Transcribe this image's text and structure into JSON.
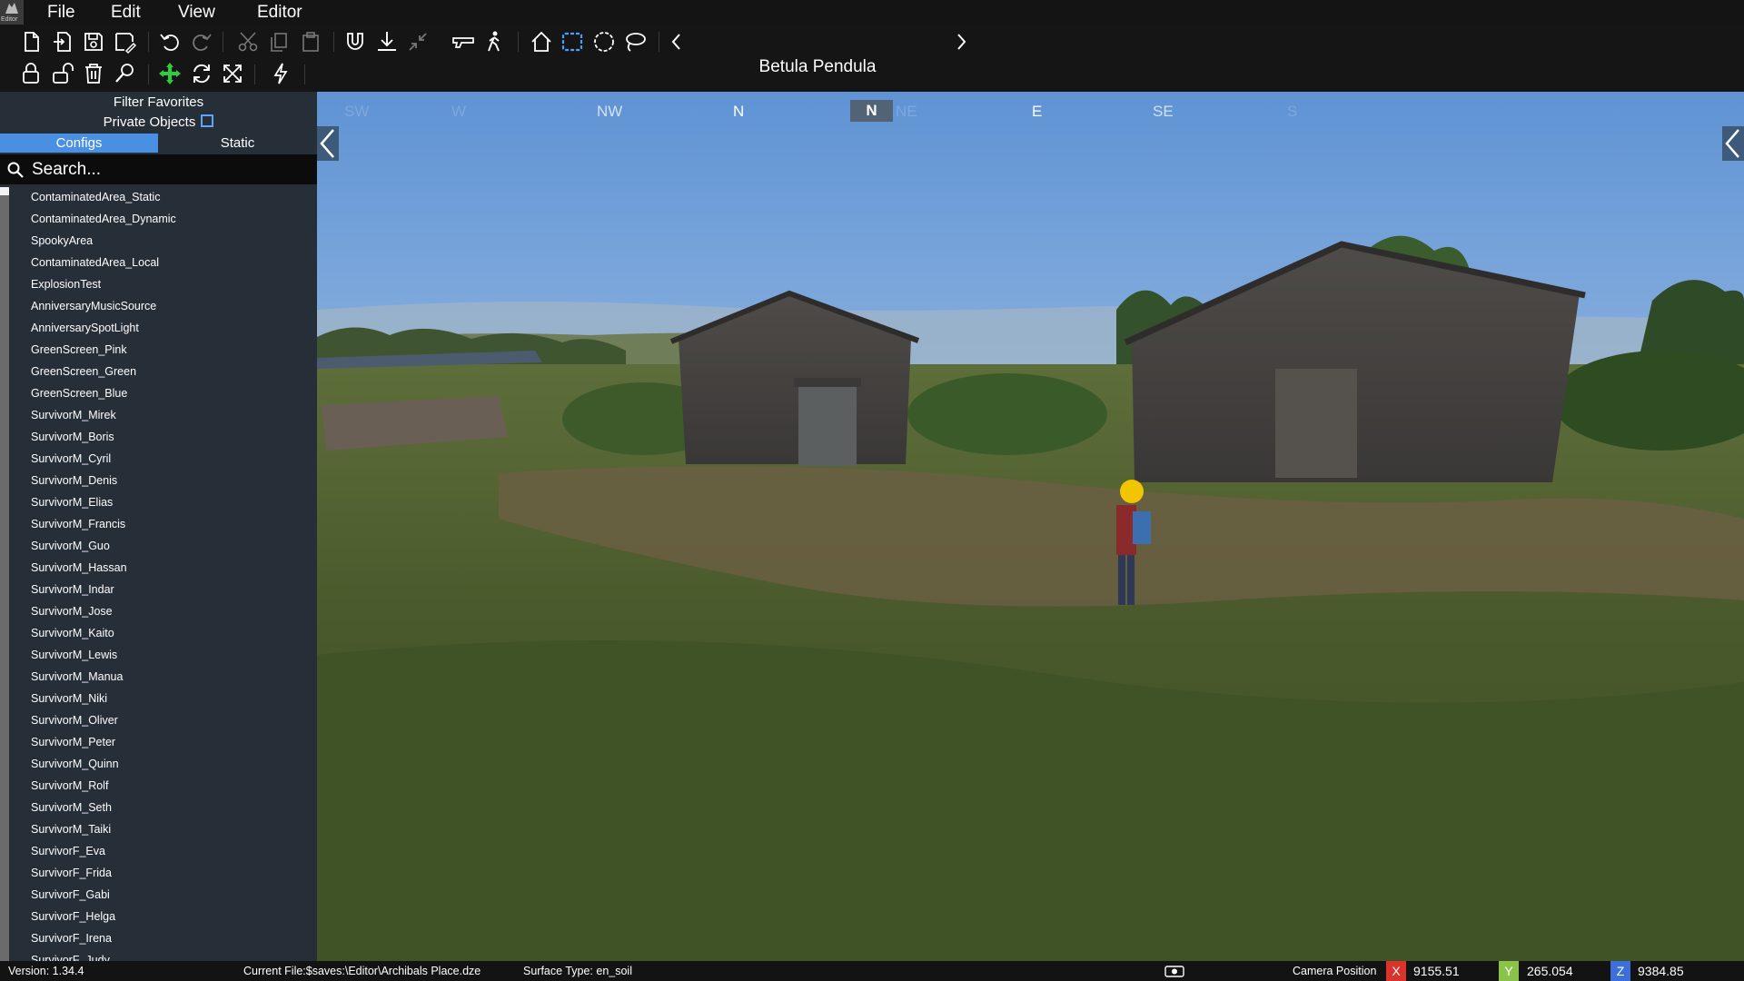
{
  "menu": {
    "logo_text": "Editor",
    "file": "File",
    "edit": "Edit",
    "view": "View",
    "editor": "Editor"
  },
  "toolbar": {
    "preset_name": "Betula Pendula",
    "accent_color": "#2ecc40",
    "icons_row1": [
      "new-file-icon",
      "import-file-icon",
      "save-icon",
      "save-as-icon",
      "undo-icon",
      "redo-icon",
      "cut-icon",
      "copy-icon",
      "paste-icon",
      "magnet-icon",
      "ground-snap-icon",
      "collapse-icon",
      "gun-icon",
      "walk-icon",
      "home-icon",
      "box-select-icon",
      "circle-select-icon",
      "lasso-select-icon",
      "prev-preset-icon",
      "next-preset-icon"
    ],
    "icons_row2": [
      "lock-icon",
      "unlock-icon",
      "trash-icon",
      "inspect-icon",
      "move-tool-icon",
      "rotate-tool-icon",
      "scale-tool-icon",
      "lightning-icon"
    ]
  },
  "sidebar": {
    "filter_favorites": "Filter Favorites",
    "private_objects": "Private Objects",
    "tabs": [
      "Configs",
      "Static"
    ],
    "active_tab": "Configs",
    "search_placeholder": "Search...",
    "items": [
      "ContaminatedArea_Static",
      "ContaminatedArea_Dynamic",
      "SpookyArea",
      "ContaminatedArea_Local",
      "ExplosionTest",
      "AnniversaryMusicSource",
      "AnniversarySpotLight",
      "GreenScreen_Pink",
      "GreenScreen_Green",
      "GreenScreen_Blue",
      "SurvivorM_Mirek",
      "SurvivorM_Boris",
      "SurvivorM_Cyril",
      "SurvivorM_Denis",
      "SurvivorM_Elias",
      "SurvivorM_Francis",
      "SurvivorM_Guo",
      "SurvivorM_Hassan",
      "SurvivorM_Indar",
      "SurvivorM_Jose",
      "SurvivorM_Kaito",
      "SurvivorM_Lewis",
      "SurvivorM_Manua",
      "SurvivorM_Niki",
      "SurvivorM_Oliver",
      "SurvivorM_Peter",
      "SurvivorM_Quinn",
      "SurvivorM_Rolf",
      "SurvivorM_Seth",
      "SurvivorM_Taiki",
      "SurvivorF_Eva",
      "SurvivorF_Frida",
      "SurvivorF_Gabi",
      "SurvivorF_Helga",
      "SurvivorF_Irena",
      "SurvivorF_Judy"
    ]
  },
  "compass": {
    "labels": [
      "SW",
      "W",
      "NW",
      "N",
      "NE",
      "E",
      "SE",
      "S"
    ],
    "current": "N"
  },
  "status": {
    "version": "Version:  1.34.4",
    "current_file": "Current File:$saves:\\Editor\\Archibals Place.dze",
    "surface_type": "Surface Type: en_soil",
    "camera_position_label": "Camera Position",
    "x_label": "X",
    "x_value": "9155.51",
    "x_color": "#d9342b",
    "y_label": "Y",
    "y_value": "265.054",
    "y_color": "#8bc34a",
    "z_label": "Z",
    "z_value": "9384.85",
    "z_color": "#3d6fd8"
  }
}
